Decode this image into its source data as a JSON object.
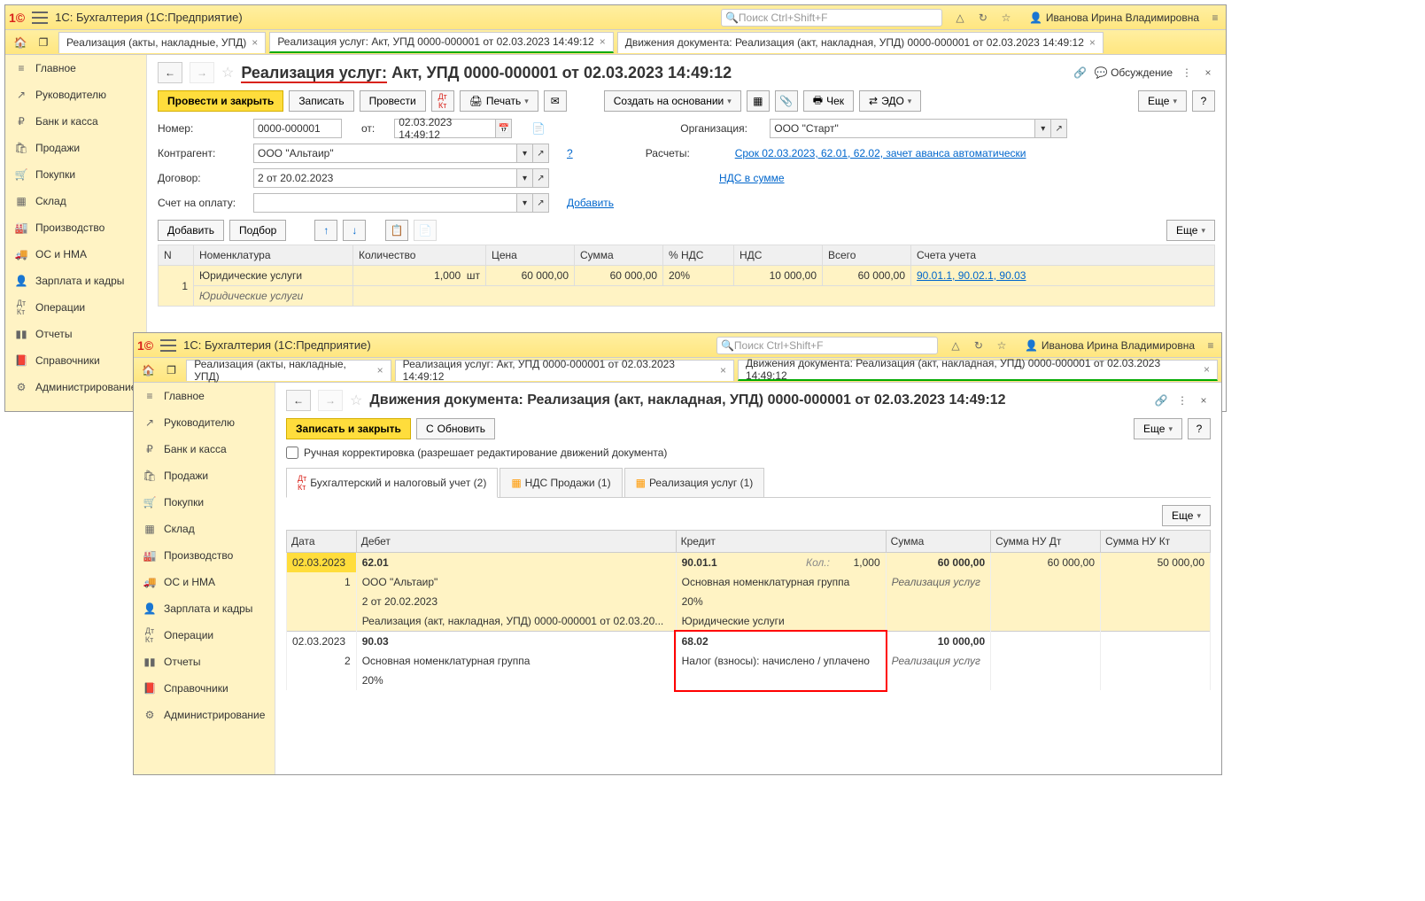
{
  "app": {
    "title": "1С: Бухгалтерия  (1С:Предприятие)",
    "search_placeholder": "Поиск Ctrl+Shift+F",
    "user": "Иванова Ирина Владимировна"
  },
  "sidebar": {
    "items": [
      "Главное",
      "Руководителю",
      "Банк и касса",
      "Продажи",
      "Покупки",
      "Склад",
      "Производство",
      "ОС и НМА",
      "Зарплата и кадры",
      "Операции",
      "Отчеты",
      "Справочники",
      "Администрирование"
    ]
  },
  "win1": {
    "tabs": [
      "Реализация (акты, накладные, УПД)",
      "Реализация услуг: Акт, УПД 0000-000001 от 02.03.2023 14:49:12",
      "Движения документа: Реализация (акт, накладная, УПД) 0000-000001 от 02.03.2023 14:49:12"
    ],
    "active_tab": 1,
    "doc_title_a": "Реализация услуг:",
    "doc_title_b": " Акт, УПД 0000-000001 от 02.03.2023 14:49:12",
    "discussion": "Обсуждение",
    "toolbar": {
      "post_close": "Провести и закрыть",
      "save": "Записать",
      "post": "Провести",
      "print": "Печать",
      "create_based": "Создать на основании",
      "check": "Чек",
      "edo": "ЭДО",
      "more": "Еще"
    },
    "fields": {
      "number_lbl": "Номер:",
      "number": "0000-000001",
      "from_lbl": "от:",
      "date": "02.03.2023 14:49:12",
      "org_lbl": "Организация:",
      "org": "ООО \"Старт\"",
      "contragent_lbl": "Контрагент:",
      "contragent": "ООО \"Альтаир\"",
      "calc_lbl": "Расчеты:",
      "calc_link": "Срок 02.03.2023, 62.01, 62.02, зачет аванса автоматически",
      "contract_lbl": "Договор:",
      "contract": "2 от 20.02.2023",
      "nds_link": "НДС в сумме",
      "invoice_lbl": "Счет на оплату:",
      "add_link": "Добавить"
    },
    "ttoolbar": {
      "add": "Добавить",
      "select": "Подбор",
      "more": "Еще"
    },
    "table": {
      "headers": [
        "N",
        "Номенклатура",
        "Количество",
        "Цена",
        "Сумма",
        "% НДС",
        "НДС",
        "Всего",
        "Счета учета"
      ],
      "row": {
        "n": "1",
        "nom": "Юридические услуги",
        "nom_sub": "Юридические услуги",
        "qty": "1,000",
        "unit": "шт",
        "price": "60 000,00",
        "sum": "60 000,00",
        "nds_pct": "20%",
        "nds": "10 000,00",
        "total": "60 000,00",
        "accounts": "90.01.1, 90.02.1, 90.03"
      }
    }
  },
  "win2": {
    "tabs": [
      "Реализация (акты, накладные, УПД)",
      "Реализация услуг: Акт, УПД 0000-000001 от 02.03.2023 14:49:12",
      "Движения документа: Реализация (акт, накладная, УПД) 0000-000001 от 02.03.2023 14:49:12"
    ],
    "active_tab": 2,
    "doc_title": "Движения документа: Реализация (акт, накладная, УПД) 0000-000001 от 02.03.2023 14:49:12",
    "toolbar": {
      "save_close": "Записать и закрыть",
      "refresh": "Обновить",
      "more": "Еще"
    },
    "manual_edit": "Ручная корректировка (разрешает редактирование движений документа)",
    "subtabs": [
      "Бухгалтерский и налоговый учет (2)",
      "НДС Продажи (1)",
      "Реализация услуг (1)"
    ],
    "more2": "Еще",
    "mheaders": [
      "Дата",
      "Дебет",
      "Кредит",
      "Сумма",
      "Сумма НУ Дт",
      "Сумма НУ Кт"
    ],
    "entry1": {
      "date": "02.03.2023",
      "n": "1",
      "dt": "62.01",
      "dt_l1": "ООО \"Альтаир\"",
      "dt_l2": "2 от 20.02.2023",
      "dt_l3": "Реализация (акт, накладная, УПД) 0000-000001 от 02.03.20...",
      "kt": "90.01.1",
      "kt_qty_lbl": "Кол.:",
      "kt_qty": "1,000",
      "kt_l1": "Основная номенклатурная группа",
      "kt_l2": "20%",
      "kt_l3": "Юридические услуги",
      "sum": "60 000,00",
      "sum_desc": "Реализация услуг",
      "nu_dt": "60 000,00",
      "nu_kt": "50 000,00"
    },
    "entry2": {
      "date": "02.03.2023",
      "n": "2",
      "dt": "90.03",
      "dt_l1": "Основная номенклатурная группа",
      "dt_l2": "20%",
      "kt": "68.02",
      "kt_l1": "Налог (взносы): начислено / уплачено",
      "sum": "10 000,00",
      "sum_desc": "Реализация услуг"
    }
  }
}
